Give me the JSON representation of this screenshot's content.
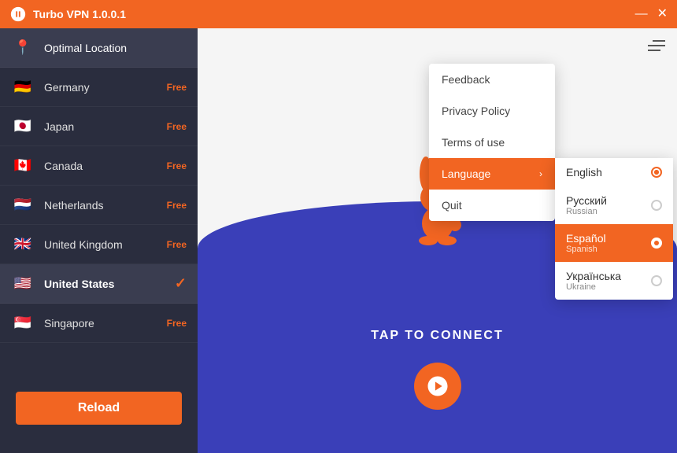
{
  "titleBar": {
    "title": "Turbo VPN  1.0.0.1",
    "minimizeLabel": "—",
    "closeLabel": "✕"
  },
  "sidebar": {
    "reloadLabel": "Reload",
    "items": [
      {
        "id": "optimal",
        "name": "Optimal Location",
        "badge": "",
        "flag": "📍",
        "active": false,
        "optimal": true,
        "selected": false
      },
      {
        "id": "germany",
        "name": "Germany",
        "badge": "Free",
        "flag": "🇩🇪",
        "active": false,
        "selected": false
      },
      {
        "id": "japan",
        "name": "Japan",
        "badge": "Free",
        "flag": "🇯🇵",
        "active": false,
        "selected": false
      },
      {
        "id": "canada",
        "name": "Canada",
        "badge": "Free",
        "flag": "🇨🇦",
        "active": false,
        "selected": false
      },
      {
        "id": "netherlands",
        "name": "Netherlands",
        "badge": "Free",
        "flag": "🇳🇱",
        "active": false,
        "selected": false
      },
      {
        "id": "uk",
        "name": "United Kingdom",
        "badge": "Free",
        "flag": "🇬🇧",
        "active": false,
        "selected": false
      },
      {
        "id": "us",
        "name": "United States",
        "badge": "",
        "flag": "🇺🇸",
        "active": true,
        "selected": true
      },
      {
        "id": "singapore",
        "name": "Singapore",
        "badge": "Free",
        "flag": "🇸🇬",
        "active": false,
        "selected": false
      }
    ]
  },
  "menu": {
    "items": [
      {
        "id": "feedback",
        "label": "Feedback",
        "hasArrow": false
      },
      {
        "id": "privacy",
        "label": "Privacy Policy",
        "hasArrow": false
      },
      {
        "id": "terms",
        "label": "Terms of use",
        "hasArrow": false
      },
      {
        "id": "language",
        "label": "Language",
        "hasArrow": true,
        "active": true
      },
      {
        "id": "quit",
        "label": "Quit",
        "hasArrow": false
      }
    ],
    "languages": [
      {
        "id": "en",
        "name": "English",
        "native": "",
        "selected": true
      },
      {
        "id": "ru",
        "name": "Русский",
        "native": "Russian",
        "selected": false
      },
      {
        "id": "es",
        "name": "Español",
        "native": "Spanish",
        "selected": true
      },
      {
        "id": "uk",
        "name": "Українська",
        "native": "Ukraine",
        "selected": false
      }
    ]
  },
  "content": {
    "tapText": "TAP TO CONNECT"
  }
}
